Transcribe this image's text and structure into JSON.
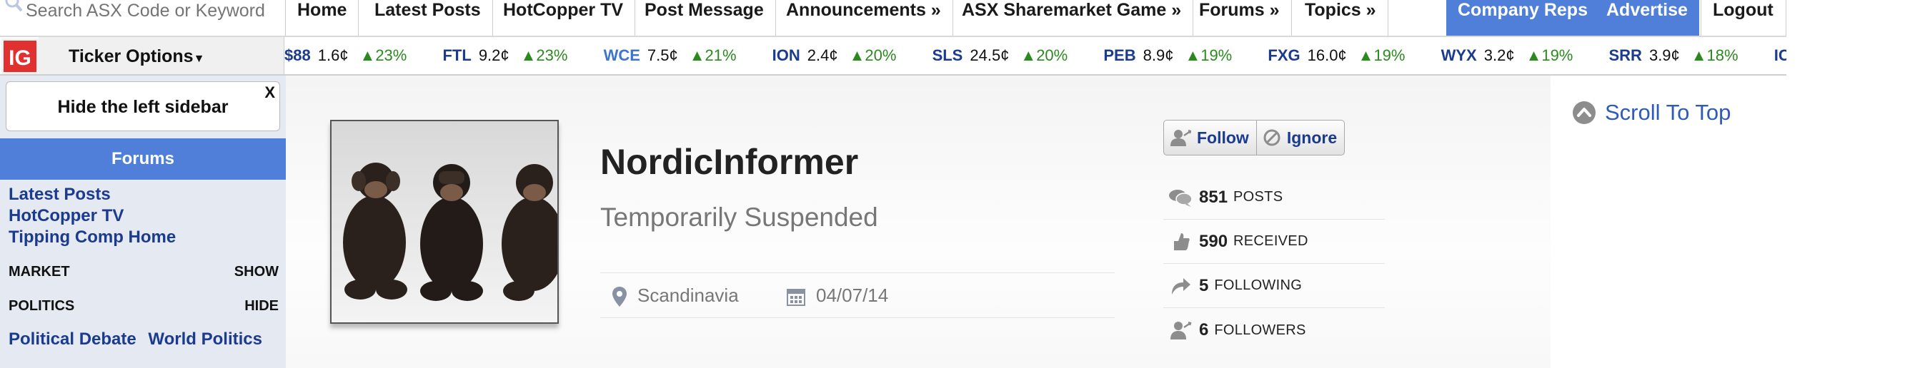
{
  "search": {
    "placeholder": "Search ASX Code or Keyword"
  },
  "nav": {
    "items": [
      "Home",
      "Latest Posts",
      "HotCopper TV",
      "Post Message",
      "Announcements »",
      "ASX Sharemarket Game »",
      "Forums »",
      "Topics »"
    ],
    "right_items": [
      "Company Reps",
      "Advertise",
      "Logout"
    ]
  },
  "ticker_bar": {
    "logo_text": "IG",
    "options_label": "Ticker Options",
    "tickers": [
      {
        "code": "$88",
        "price": "1.6¢",
        "change": "▲23%"
      },
      {
        "code": "FTL",
        "price": "9.2¢",
        "change": "▲23%"
      },
      {
        "code": "WCE",
        "price": "7.5¢",
        "change": "▲21%"
      },
      {
        "code": "ION",
        "price": "2.4¢",
        "change": "▲20%"
      },
      {
        "code": "SLS",
        "price": "24.5¢",
        "change": "▲20%"
      },
      {
        "code": "PEB",
        "price": "8.9¢",
        "change": "▲19%"
      },
      {
        "code": "FXG",
        "price": "16.0¢",
        "change": "▲19%"
      },
      {
        "code": "WYX",
        "price": "3.2¢",
        "change": "▲19%"
      },
      {
        "code": "SRR",
        "price": "3.9¢",
        "change": "▲18%"
      },
      {
        "code": "ICL",
        "price": "",
        "change": ""
      }
    ],
    "up_color": "#2a8a1e"
  },
  "sidebar": {
    "hide_label": "Hide the left sidebar",
    "close_label": "X",
    "forums_header": "Forums",
    "links": [
      "Latest Posts",
      "HotCopper TV",
      "Tipping Comp Home"
    ],
    "sections": [
      {
        "name": "MARKET",
        "toggle": "SHOW"
      },
      {
        "name": "POLITICS",
        "toggle": "HIDE"
      }
    ],
    "politics_links": [
      "Political Debate",
      "World Politics"
    ]
  },
  "profile": {
    "username": "NordicInformer",
    "status": "Temporarily Suspended",
    "location": "Scandinavia",
    "joined": "04/07/14",
    "follow_label": "Follow",
    "ignore_label": "Ignore",
    "stats": [
      {
        "value": "851",
        "label": "Posts",
        "icon": "chat-bubbles-icon"
      },
      {
        "value": "590",
        "label": "Received",
        "icon": "thumbs-up-icon"
      },
      {
        "value": "5",
        "label": "Following",
        "icon": "share-arrow-icon"
      },
      {
        "value": "6",
        "label": "Followers",
        "icon": "followers-icon"
      }
    ]
  },
  "right": {
    "scroll_top_label": "Scroll To Top"
  },
  "colors": {
    "accent_blue": "#4f7fd8",
    "link_blue": "#1b3b8f",
    "ig_red": "#e0302f"
  }
}
